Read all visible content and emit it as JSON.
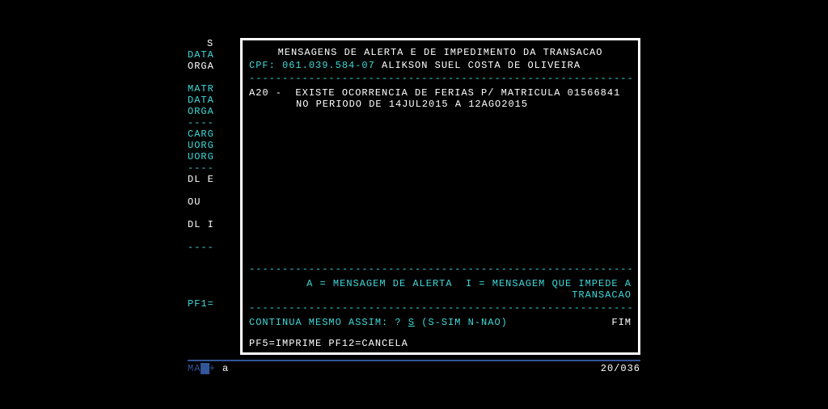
{
  "leftColumn": {
    "topS": "S",
    "data1": "DATA",
    "orga1": "ORGA",
    "matr": "MATR",
    "data2": "DATA",
    "orga2": "ORGA",
    "dashes1": "----",
    "carg": "CARG",
    "uorg1": "UORG",
    "uorg2": "UORG",
    "dashes2": "----",
    "dlE": "DL E",
    "ou": "OU",
    "dlI": "DL I",
    "dashes3": "----",
    "pf1": "PF1="
  },
  "main": {
    "title": "MENSAGENS DE ALERTA E DE IMPEDIMENTO DA TRANSACAO",
    "cpfLabel": "CPF:",
    "cpfValue": "061.039.584-07",
    "personName": "ALIKSON SUEL COSTA DE OLIVEIRA",
    "divider": "----------------------------------------------------------------",
    "msgCode": "A20",
    "msgLine1": "EXISTE OCORRENCIA DE FERIAS P/ MATRICULA 01566841",
    "msgLine2": "NO PERIODO DE 14JUL2015 A 12AGO2015",
    "legendA": "A = MENSAGEM DE ALERTA",
    "legendI": "I = MENSAGEM QUE IMPEDE A  TRANSACAO",
    "continuePrompt": "CONTINUA MESMO ASSIM: ?",
    "continueValue": "S",
    "continueHint": "(S-SIM N-NAO)",
    "fim": "FIM",
    "pfKeys": "PF5=IMPRIME PF12=CANCELA"
  },
  "statusBar": {
    "left": "MA",
    "plus": "+",
    "a": "a",
    "position": "20/036"
  }
}
